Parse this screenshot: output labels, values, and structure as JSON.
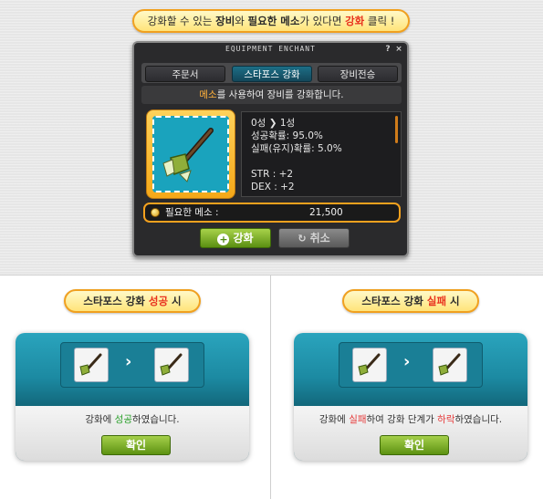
{
  "top_callout": {
    "p1": "강화할 수 있는 ",
    "p2": "장비",
    "p3": "와 ",
    "p4": "필요한 메소",
    "p5": "가 있다면 ",
    "p6": "강화",
    "p7": " 클릭 !"
  },
  "window": {
    "title": "EQUIPMENT ENCHANT",
    "help": "?",
    "close": "×",
    "tabs": [
      "주문서",
      "스타포스 강화",
      "장비전승"
    ],
    "active_tab": "스타포스 강화",
    "desc_highlight": "메소",
    "desc_rest": "를 사용하여 장비를 강화합니다.",
    "star_from": "0성",
    "star_arrow": "❯",
    "star_to": "1성",
    "success_rate": "성공확률: 95.0%",
    "fail_rate": "실패(유지)확률: 5.0%",
    "str_line": "STR : +2",
    "dex_line": "DEX : +2",
    "cost_label": "필요한 메소 :",
    "cost_value": "21,500",
    "enhance_button": "강화",
    "cancel_button": "취소"
  },
  "success_panel": {
    "label_a": "스타포스 강화 ",
    "label_b": "성공",
    "label_c": " 시",
    "text_a": "강화에 ",
    "text_b": "성공",
    "text_c": "하였습니다.",
    "ok_button": "확인"
  },
  "fail_panel": {
    "label_a": "스타포스 강화 ",
    "label_b": "실패",
    "label_c": " 시",
    "text_a": "강화에 ",
    "text_b": "실패",
    "text_c": "하여 강화 단계가 ",
    "text_d": "하락",
    "text_e": "하였습니다.",
    "ok_button": "확인"
  },
  "colors": {
    "accent_orange": "#f0a020",
    "highlight_red": "#e8321e",
    "dialog_teal": "#1c8aa2",
    "button_green": "#5b8f12"
  },
  "icons": [
    "coin-icon",
    "plus-circle-icon",
    "refresh-icon",
    "weapon-icon",
    "arrow-right-icon"
  ]
}
